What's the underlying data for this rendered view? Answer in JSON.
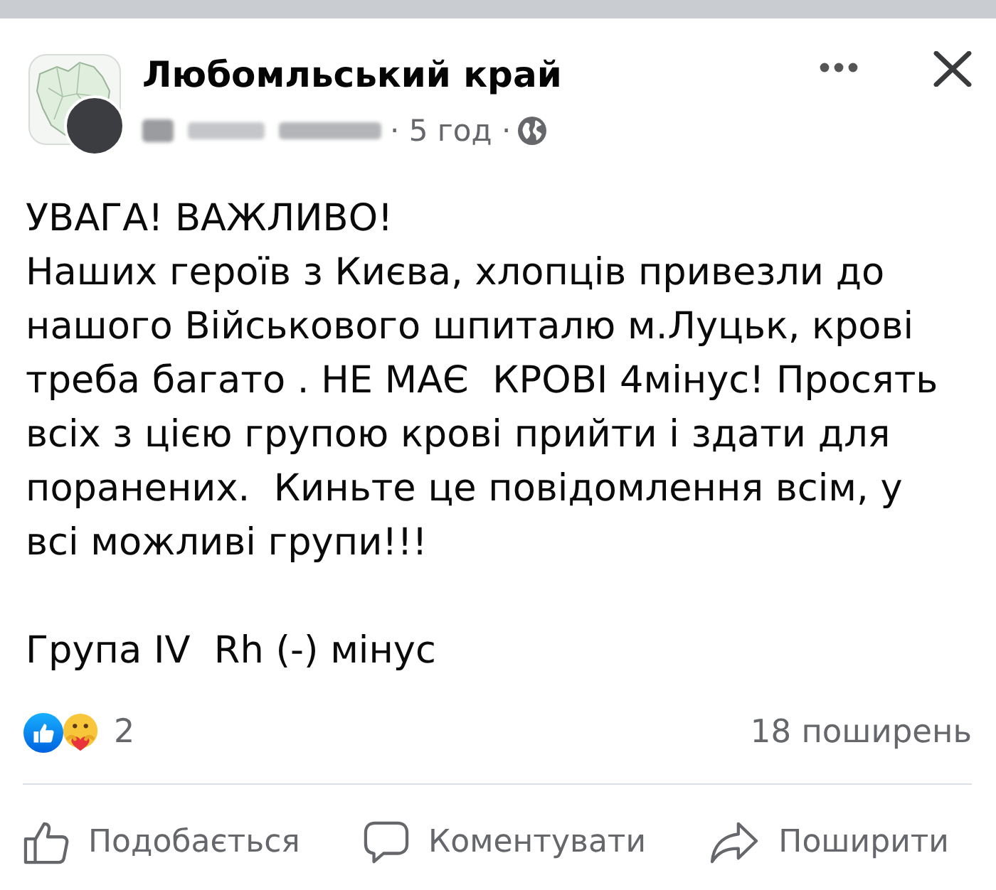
{
  "post": {
    "group_name": "Любомльський край",
    "time": "· 5 год ·",
    "paragraphs": [
      "УВАГА! ВАЖЛИВО!\nНаших героїв з Києва, хлопців привезли до\nнашого Військового шпиталю м.Луцьк, крові\nтреба багато . НЕ МАЄ  КРОВІ 4мінус! Просять\nвсіх з цією групою крові прийти і здати для\nпоранених.  Киньте це повідомлення всім, у\nвсі можливі групи!!!",
      "Група IV  Rh (-) мінус"
    ]
  },
  "summary": {
    "reaction_count": "2",
    "shares": "18 поширень"
  },
  "actions": [
    {
      "kind": "like",
      "label": "Подобається"
    },
    {
      "kind": "comment",
      "label": "Коментувати"
    },
    {
      "kind": "share",
      "label": "Поширити"
    }
  ]
}
